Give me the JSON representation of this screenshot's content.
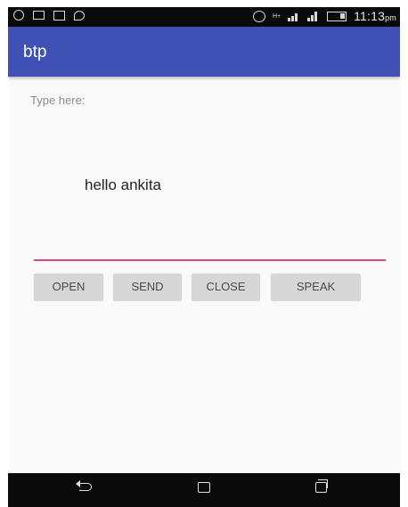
{
  "status_bar": {
    "time": "11:13",
    "time_suffix": "pm",
    "network_label": "H+",
    "left_icons": [
      "whatsapp-icon",
      "message-icon",
      "gallery-icon",
      "chat-icon"
    ],
    "right_icons": [
      "alarm-icon",
      "network-icon",
      "signal-icon",
      "signal-icon",
      "battery-icon"
    ]
  },
  "app_bar": {
    "title": "btp",
    "color": "#3f51b5"
  },
  "content": {
    "input_label": "Type here:",
    "input_value": "hello ankita",
    "underline_color": "#e0457b"
  },
  "buttons": {
    "open": "OPEN",
    "send": "SEND",
    "close": "CLOSE",
    "speak": "SPEAK"
  },
  "nav_bar": {
    "icons": [
      "back-icon",
      "home-icon",
      "recent-apps-icon"
    ]
  }
}
